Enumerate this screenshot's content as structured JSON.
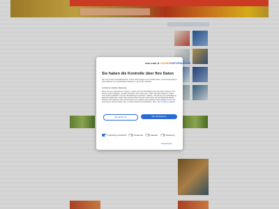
{
  "consent": {
    "logo": {
      "brand": "one.com",
      "separator": " & ",
      "partner": "COOKIE",
      "partner2": "INFORMATION"
    },
    "title": "Sie haben die Kontrolle über Ihre Daten",
    "intro": "Wir und unsere Geschäftspartner nutzen Technologien wie Cookies dazu, personenbezogene Informationen für verschiedene Zwecke zu sammeln, darunter:",
    "purposes": "Funktional, Statistik, Marketing",
    "details": "Wenn Sie auf „Akzeptieren“ klicken, erteilen Sie Ihre Einwilligung für alle diese Zwecke. Sie können auch festlegen, welchen Zwecken Sie zustimmen, indem Sie das Kästchen neben dem Zweck anklicken und auf „Einstellungen speichern“ klicken. Sie können Ihre Einwilligung jederzeit widerrufen, indem Sie auf das kleine Symbol unten links auf der Webseite klicken. Weitere Informationen über die Nutzung von Cookies oder anderen Technologien durch uns und unsere Partner finden Sie in unserer Datenschutzrichtlinie.",
    "link_label": "Mehr über Cookies erfahren",
    "reject_label": "Alle ablehnen",
    "accept_label": "Alle akzeptieren",
    "toggles": [
      {
        "label": "Unbedingt erforderlich",
        "on": true
      },
      {
        "label": "Funktional",
        "on": false
      },
      {
        "label": "Statistik",
        "on": false
      },
      {
        "label": "Marketing",
        "on": false
      }
    ],
    "settings_label": "Einstellungen",
    "accent": "#2a6ad8"
  }
}
